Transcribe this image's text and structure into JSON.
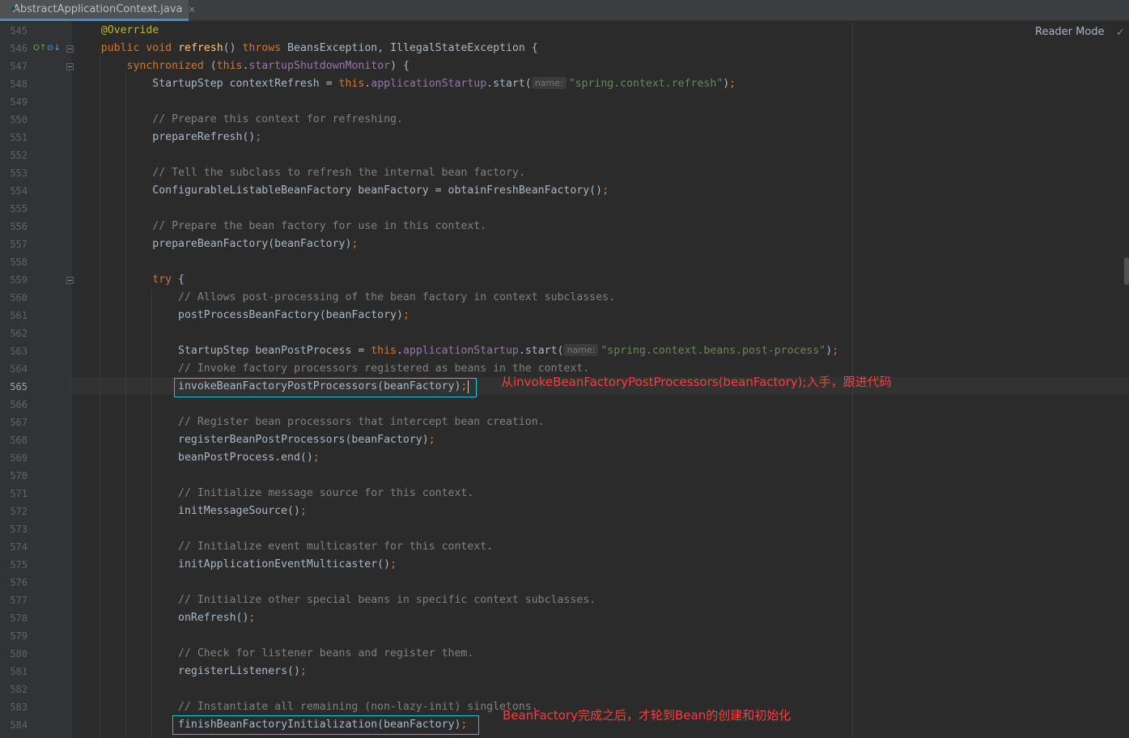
{
  "tab": {
    "filename": "AbstractApplicationContext.java",
    "close": "×"
  },
  "toolbar": {
    "reader_mode": "Reader Mode",
    "check": "✓"
  },
  "gutter": {
    "line_numbers": [
      "545",
      "546",
      "547",
      "548",
      "549",
      "550",
      "551",
      "552",
      "553",
      "554",
      "555",
      "556",
      "557",
      "558",
      "559",
      "560",
      "561",
      "562",
      "563",
      "564",
      "565",
      "566",
      "567",
      "568",
      "569",
      "570",
      "571",
      "572",
      "573",
      "574",
      "575",
      "576",
      "577",
      "578",
      "579",
      "580",
      "581",
      "582",
      "583",
      "584"
    ],
    "current_line": "565",
    "override_icon": "O↑",
    "implemented_icon": "⊙↓"
  },
  "code": {
    "l545": "@Override",
    "l546": {
      "public": "public",
      "void": "void",
      "method": "refresh",
      "sig": "() ",
      "throws": "throws",
      "rest": " BeansException, IllegalStateException {"
    },
    "l547": {
      "kw": "synchronized",
      "open": " (",
      "this": "this",
      "dot": ".",
      "field": "startupShutdownMonitor",
      "close": ") {"
    },
    "l548": {
      "decl": "StartupStep contextRefresh = ",
      "this": "this",
      "dot": ".",
      "field": "applicationStartup",
      "call": ".start(",
      "hint": "name:",
      "str": "\"spring.context.refresh\"",
      "end": ")",
      "semi": ";"
    },
    "l550": "// Prepare this context for refreshing.",
    "l551": {
      "call": "prepareRefresh()",
      "semi": ";"
    },
    "l553": "// Tell the subclass to refresh the internal bean factory.",
    "l554": {
      "call": "ConfigurableListableBeanFactory beanFactory = obtainFreshBeanFactory()",
      "semi": ";"
    },
    "l556": "// Prepare the bean factory for use in this context.",
    "l557": {
      "call": "prepareBeanFactory(beanFactory)",
      "semi": ";"
    },
    "l559": {
      "kw": "try",
      "rest": " {"
    },
    "l560": "// Allows post-processing of the bean factory in context subclasses.",
    "l561": {
      "call": "postProcessBeanFactory(beanFactory)",
      "semi": ";"
    },
    "l563": {
      "decl": "StartupStep beanPostProcess = ",
      "this": "this",
      "dot": ".",
      "field": "applicationStartup",
      "call": ".start(",
      "hint": "name:",
      "str": "\"spring.context.beans.post-process\"",
      "end": ")",
      "semi": ";"
    },
    "l564": "// Invoke factory processors registered as beans in the context.",
    "l565": {
      "call": "invokeBeanFactoryPostProcessors(beanFactory)",
      "semi": ";"
    },
    "l567": "// Register bean processors that intercept bean creation.",
    "l568": {
      "call": "registerBeanPostProcessors(beanFactory)",
      "semi": ";"
    },
    "l569": {
      "call": "beanPostProcess.end()",
      "semi": ";"
    },
    "l571": "// Initialize message source for this context.",
    "l572": {
      "call": "initMessageSource()",
      "semi": ";"
    },
    "l574": "// Initialize event multicaster for this context.",
    "l575": {
      "call": "initApplicationEventMulticaster()",
      "semi": ";"
    },
    "l577": "// Initialize other special beans in specific context subclasses.",
    "l578": {
      "call": "onRefresh()",
      "semi": ";"
    },
    "l580": "// Check for listener beans and register them.",
    "l581": {
      "call": "registerListeners()",
      "semi": ";"
    },
    "l583": "// Instantiate all remaining (non-lazy-init) singletons.",
    "l584": {
      "call": "finishBeanFactoryInitialization(beanFactory)",
      "semi": ";"
    }
  },
  "annotations": {
    "note1": "从invokeBeanFactoryPostProcessors(beanFactory);入手，跟进代码",
    "note2": "BeanFactory完成之后，才轮到Bean的创建和初始化",
    "color": "#ff3b3b",
    "box_color": "#20c3d0"
  }
}
